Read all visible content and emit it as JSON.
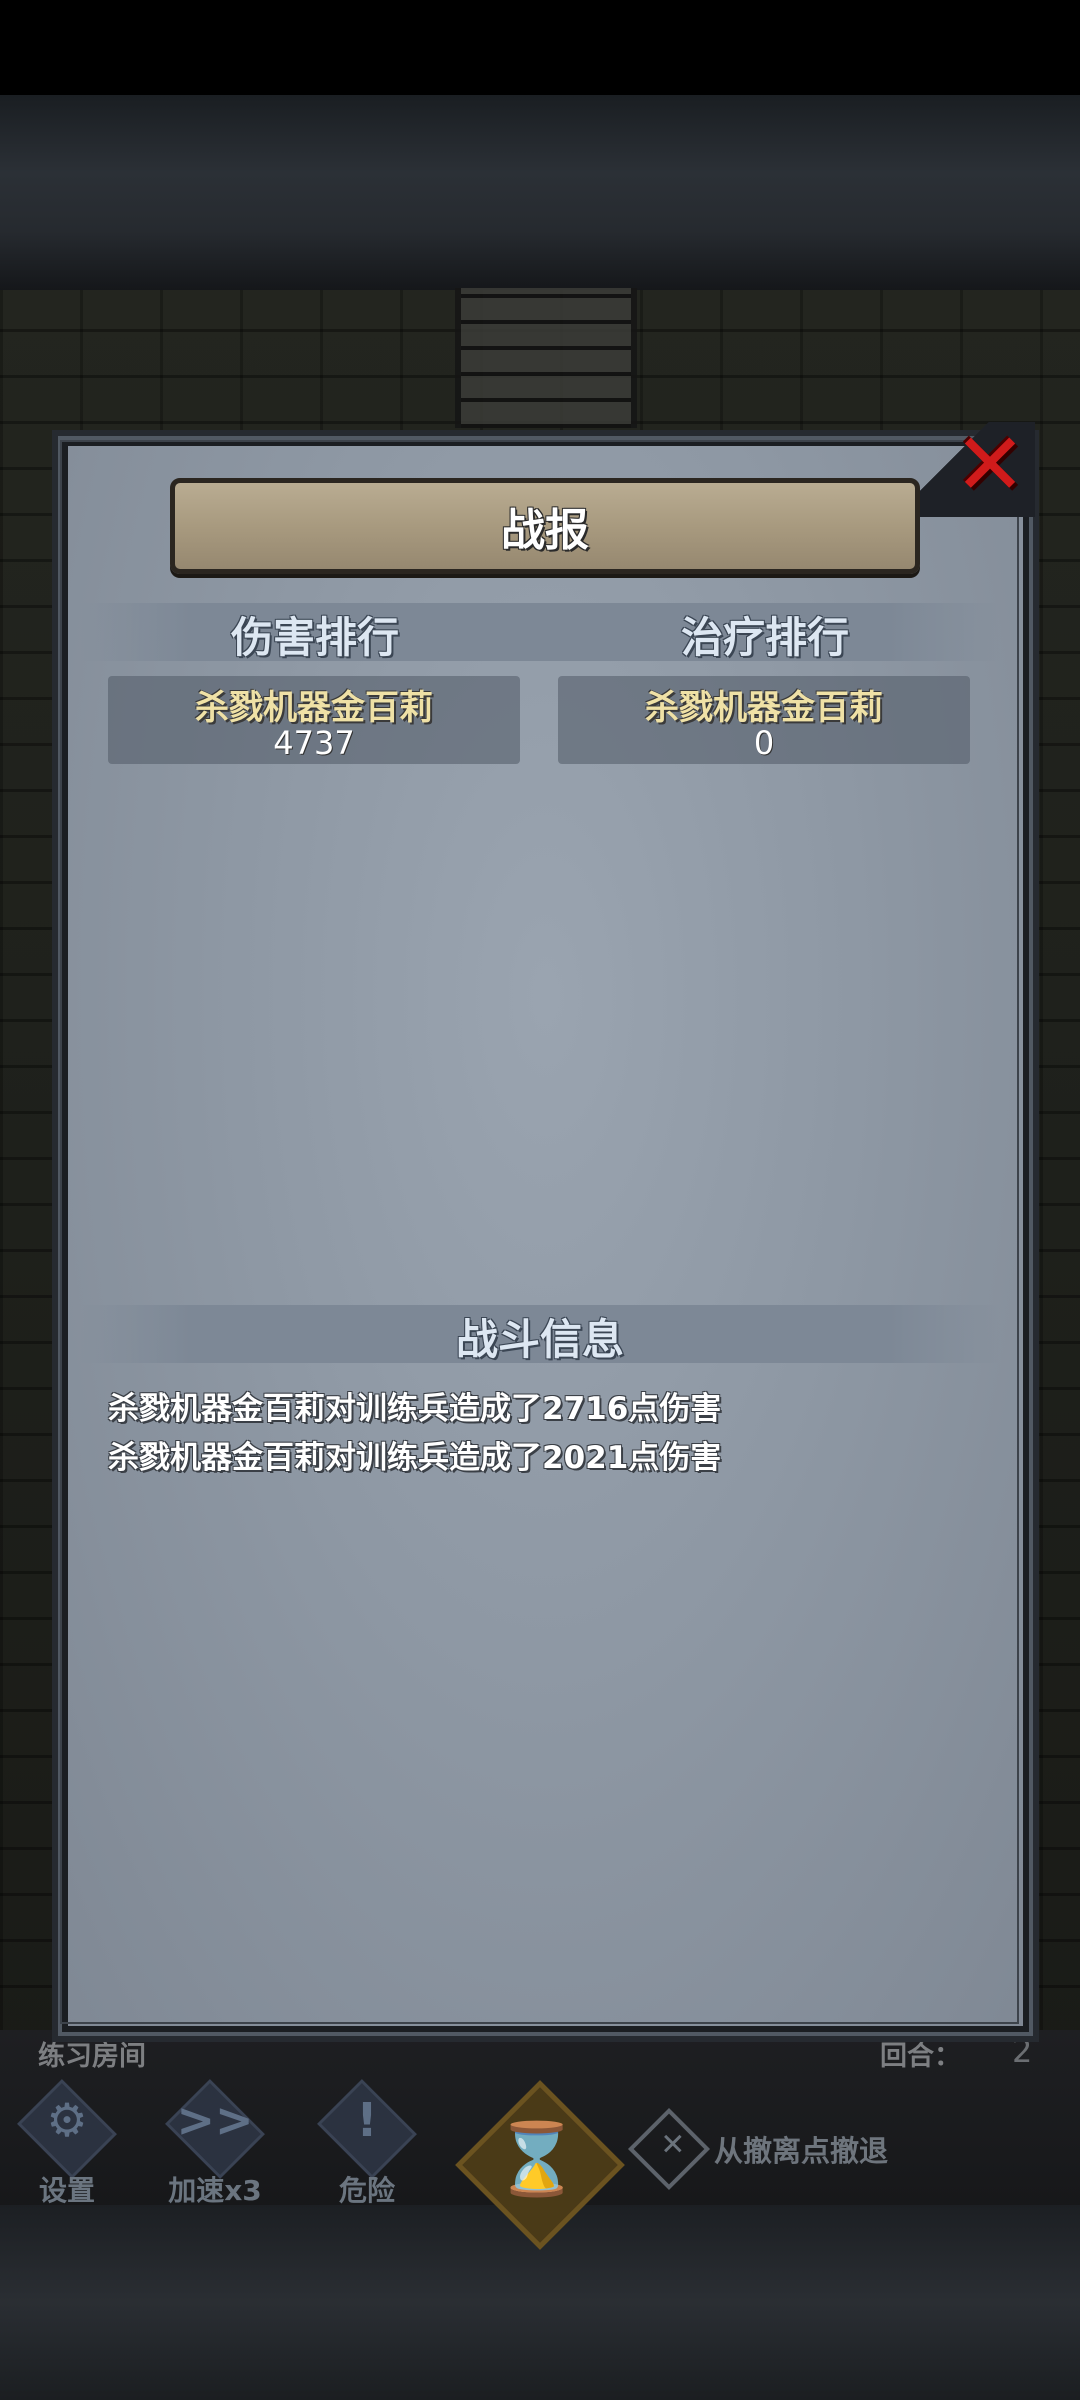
{
  "dialog": {
    "title": "战报",
    "close_icon": "red-x-icon",
    "damage_section": {
      "title": "伤害排行",
      "entries": [
        {
          "name": "杀戮机器金百莉",
          "value": "4737"
        }
      ]
    },
    "healing_section": {
      "title": "治疗排行",
      "entries": [
        {
          "name": "杀戮机器金百莉",
          "value": "0"
        }
      ]
    },
    "battle_info": {
      "title": "战斗信息",
      "lines": [
        "杀戮机器金百莉对训练兵造成了2716点伤害",
        "杀戮机器金百莉对训练兵造成了2021点伤害"
      ]
    }
  },
  "hud": {
    "room_name": "练习房间",
    "round_label": "回合：",
    "round_value": "2",
    "buttons": [
      {
        "label": "设置",
        "icon": "gear-icon",
        "glyph": "⚙"
      },
      {
        "label": "加速x3",
        "icon": "fast-forward-icon",
        "glyph": ">>"
      },
      {
        "label": "危险",
        "icon": "exclamation-icon",
        "glyph": "!"
      }
    ],
    "hourglass_glyph": "⌛",
    "retreat_glyph": "✕",
    "retreat_label": "从撤离点撤退"
  },
  "colors": {
    "close_red": "#d01b1b",
    "name_gold": "#efe1a6",
    "panel_blue_gray": "#8e98a4"
  }
}
